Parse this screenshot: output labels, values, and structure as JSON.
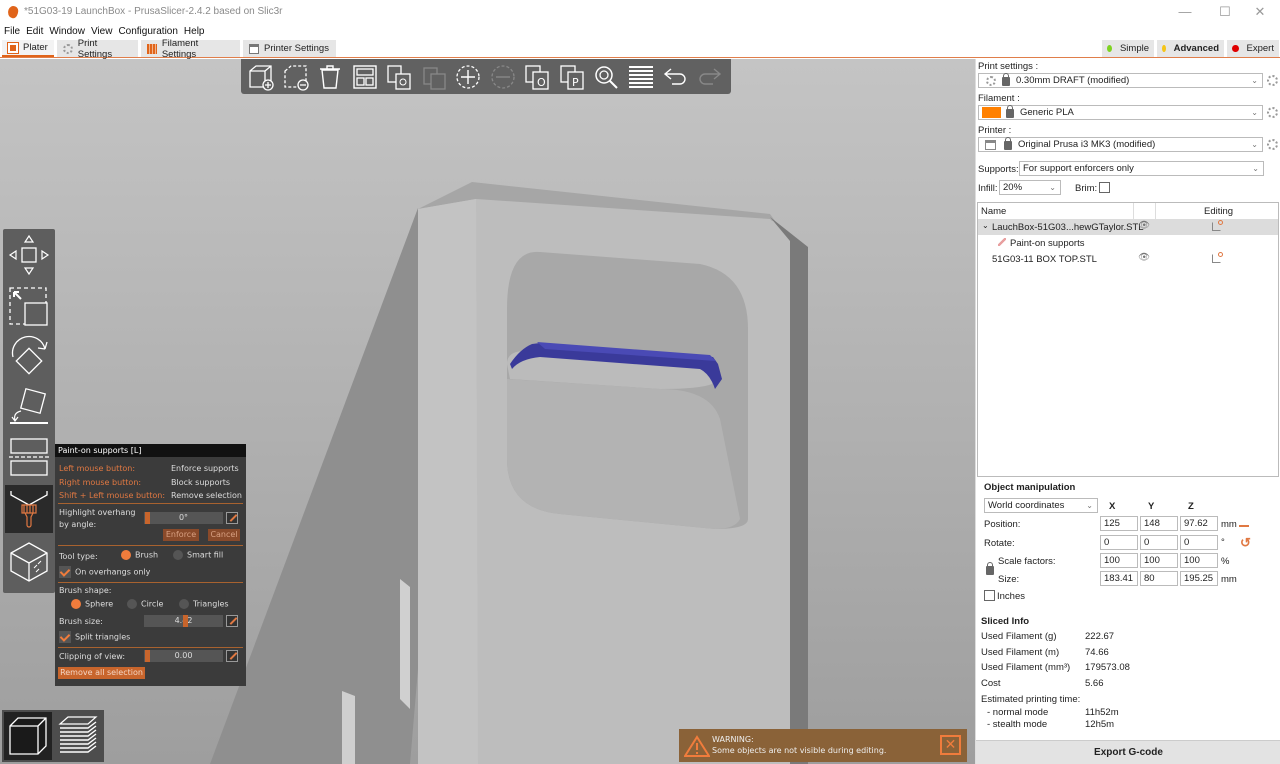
{
  "window": {
    "title": "*51G03-19 LaunchBox - PrusaSlicer-2.4.2 based on Slic3r",
    "controls": {
      "minimize": "—",
      "maximize": "☐",
      "close": "✕"
    }
  },
  "menu": [
    "File",
    "Edit",
    "Window",
    "View",
    "Configuration",
    "Help"
  ],
  "tabs": [
    {
      "label": "Plater",
      "icon": "plater-icon",
      "active": true
    },
    {
      "label": "Print Settings",
      "icon": "gear-icon"
    },
    {
      "label": "Filament Settings",
      "icon": "filament-spool-icon"
    },
    {
      "label": "Printer Settings",
      "icon": "printer-icon"
    }
  ],
  "modes": [
    {
      "label": "Simple",
      "color": "#7ed321"
    },
    {
      "label": "Advanced",
      "color": "#f5c518",
      "active": true
    },
    {
      "label": "Expert",
      "color": "#e00000"
    }
  ],
  "toolbar": [
    "add-object",
    "delete-selection",
    "delete-all",
    "arrange",
    "copy",
    "paste",
    "add-instance",
    "remove-instance",
    "split-to-objects",
    "split-to-parts",
    "search",
    "variable-layer-height",
    "undo",
    "redo"
  ],
  "gizmos": [
    "move",
    "scale",
    "rotate",
    "place-on-face",
    "cut",
    "paint-on-supports",
    "seam-painting"
  ],
  "paint_panel": {
    "title": "Paint-on supports [L]",
    "hints": [
      {
        "key": "Left mouse button:",
        "action": "Enforce supports"
      },
      {
        "key": "Right mouse button:",
        "action": "Block supports"
      },
      {
        "key": "Shift + Left mouse button:",
        "action": "Remove selection"
      }
    ],
    "highlight_label_1": "Highlight overhang",
    "highlight_label_2": "by angle:",
    "highlight_value": "0°",
    "enforce": "Enforce",
    "cancel": "Cancel",
    "tool_type_label": "Tool type:",
    "tool_brush": "Brush",
    "tool_smartfill": "Smart fill",
    "on_overhangs_only": "On overhangs only",
    "brush_shape_label": "Brush shape:",
    "shape_sphere": "Sphere",
    "shape_circle": "Circle",
    "shape_triangles": "Triangles",
    "brush_size_label": "Brush size:",
    "brush_size_value": "4.42",
    "split_triangles": "Split triangles",
    "clipping_label": "Clipping of view:",
    "clipping_value": "0.00",
    "remove_all": "Remove all selection"
  },
  "warning": {
    "title": "WARNING:",
    "message": "Some objects are not visible during editing."
  },
  "sidebar": {
    "print_settings_label": "Print settings :",
    "print_settings_value": "0.30mm DRAFT (modified)",
    "filament_label": "Filament :",
    "filament_value": "Generic PLA",
    "filament_color": "#ff8000",
    "printer_label": "Printer :",
    "printer_value": "Original Prusa i3 MK3 (modified)",
    "supports_label": "Supports:",
    "supports_value": "For support enforcers only",
    "infill_label": "Infill:",
    "infill_value": "20%",
    "brim_label": "Brim:",
    "brim_checked": false
  },
  "object_list": {
    "col_name": "Name",
    "col_editing": "Editing",
    "items": [
      {
        "name": "LauchBox-51G03...hewGTaylor.STL",
        "expanded": true,
        "selected": true
      },
      {
        "name": "Paint-on supports",
        "child": true
      },
      {
        "name": "51G03-11 BOX TOP.STL"
      }
    ]
  },
  "object_manipulation": {
    "title": "Object manipulation",
    "coord_system": "World coordinates",
    "axes": [
      "X",
      "Y",
      "Z"
    ],
    "position_label": "Position:",
    "position": [
      "125",
      "148",
      "97.62"
    ],
    "position_unit": "mm",
    "rotate_label": "Rotate:",
    "rotate": [
      "0",
      "0",
      "0"
    ],
    "rotate_unit": "°",
    "scale_label": "Scale factors:",
    "scale": [
      "100",
      "100",
      "100"
    ],
    "scale_unit": "%",
    "size_label": "Size:",
    "size": [
      "183.41",
      "80",
      "195.25"
    ],
    "size_unit": "mm",
    "inches_label": "Inches"
  },
  "sliced_info": {
    "title": "Sliced Info",
    "rows": [
      {
        "label": "Used Filament (g)",
        "value": "222.67"
      },
      {
        "label": "Used Filament (m)",
        "value": "74.66"
      },
      {
        "label": "Used Filament (mm³)",
        "value": "179573.08"
      },
      {
        "label": "Cost",
        "value": "5.66"
      }
    ],
    "time_label": "Estimated printing time:",
    "normal_label": "- normal mode",
    "normal_value": "11h52m",
    "stealth_label": "- stealth mode",
    "stealth_value": "12h5m"
  },
  "export_button": "Export G-code"
}
